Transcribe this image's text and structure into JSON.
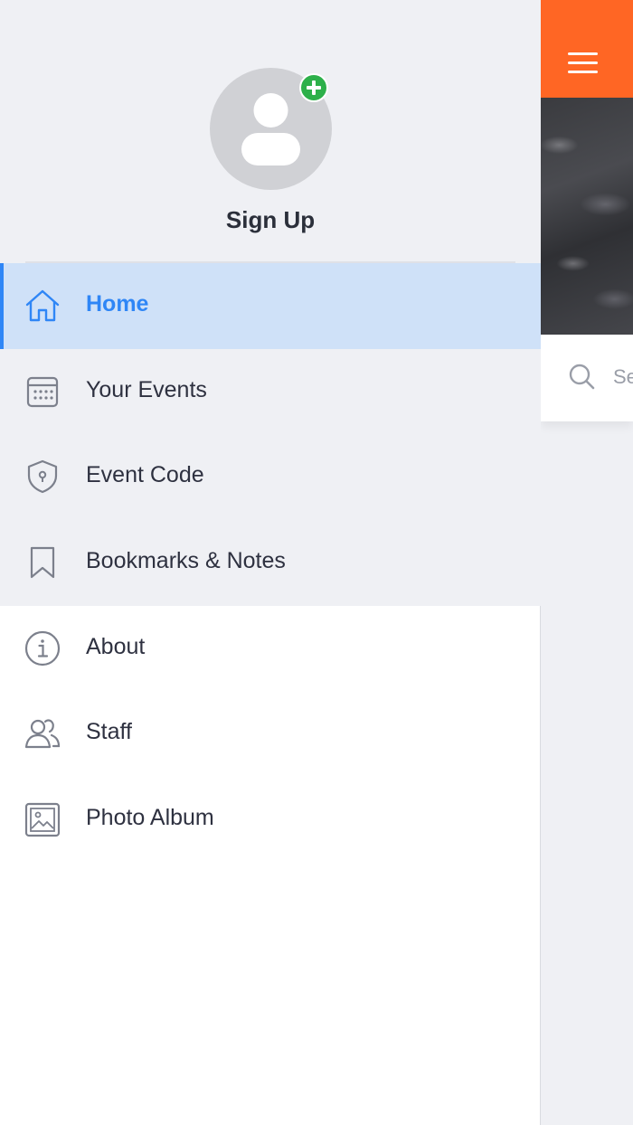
{
  "main": {
    "topbar_color": "#ff6624",
    "menu_icon": "hamburger-menu-icon",
    "search": {
      "icon": "search-icon",
      "placeholder_partial": "Se"
    }
  },
  "drawer": {
    "profile": {
      "avatar_icon": "user-placeholder-icon",
      "badge_icon": "plus-icon",
      "label": "Sign Up"
    },
    "items": [
      {
        "label": "Home",
        "icon": "home-icon",
        "active": true
      },
      {
        "label": "Your Events",
        "icon": "calendar-icon",
        "active": false
      },
      {
        "label": "Event Code",
        "icon": "shield-icon",
        "active": false
      },
      {
        "label": "Bookmarks & Notes",
        "icon": "bookmark-icon",
        "active": false
      },
      {
        "label": "About",
        "icon": "info-icon",
        "active": false
      },
      {
        "label": "Staff",
        "icon": "staff-icon",
        "active": false
      },
      {
        "label": "Photo Album",
        "icon": "photo-album-icon",
        "active": false
      }
    ],
    "accent_color": "#2f86f6"
  }
}
